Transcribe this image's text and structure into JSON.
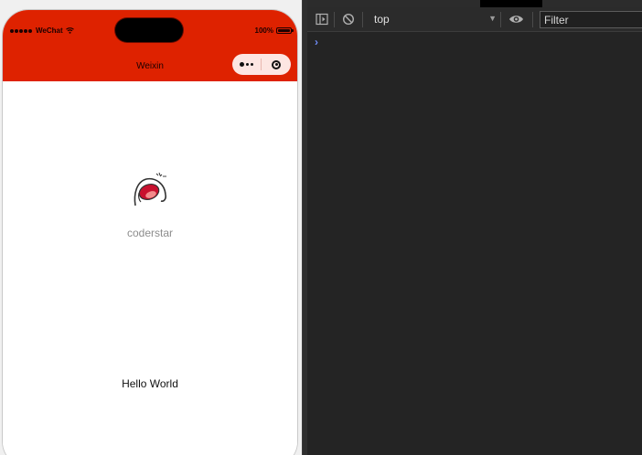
{
  "simulator": {
    "status_bar": {
      "carrier": "WeChat",
      "battery": "100%"
    },
    "nav": {
      "title": "Weixin"
    },
    "page": {
      "username": "coderstar",
      "greeting": "Hello World"
    },
    "colors": {
      "header_bg": "#de2200",
      "page_bg": "#ffffff",
      "username_color": "#8c8c8c"
    }
  },
  "devtools": {
    "context": "top",
    "filter_placeholder": "Filter",
    "prompt": "›",
    "tab_stub": "ꜱᴛ˂",
    "colors": {
      "bg": "#242424",
      "toolbar_bg": "#2b2b2b",
      "prompt_color": "#6f8cf5"
    },
    "icons": [
      "sidebar-toggle-icon",
      "clear-console-icon",
      "dropdown-caret-icon",
      "eye-icon"
    ]
  }
}
